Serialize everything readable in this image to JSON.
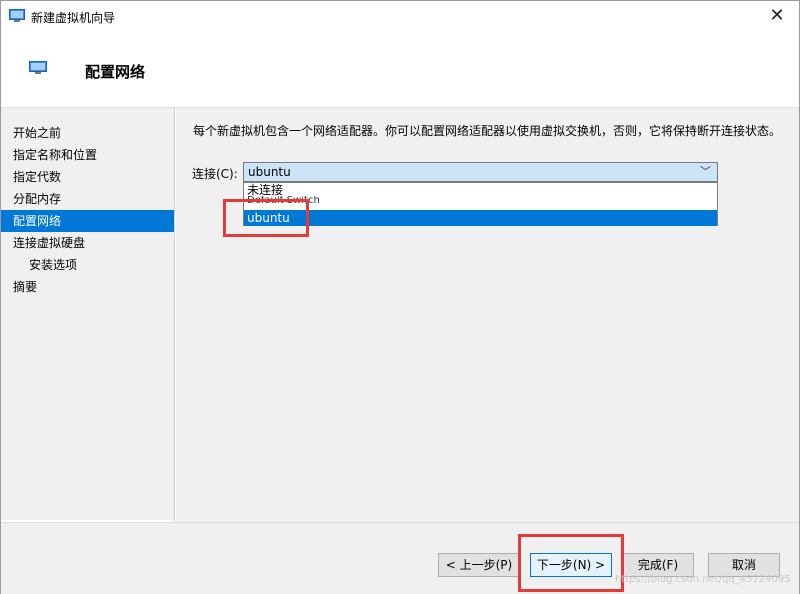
{
  "window": {
    "title": "新建虚拟机向导",
    "close_glyph": "✕"
  },
  "header": {
    "title": "配置网络"
  },
  "sidebar": {
    "items": [
      {
        "label": "开始之前"
      },
      {
        "label": "指定名称和位置"
      },
      {
        "label": "指定代数"
      },
      {
        "label": "分配内存"
      },
      {
        "label": "配置网络",
        "active": true
      },
      {
        "label": "连接虚拟硬盘"
      },
      {
        "label": "安装选项"
      },
      {
        "label": "摘要"
      }
    ]
  },
  "content": {
    "description": "每个新虚拟机包含一个网络适配器。你可以配置网络适配器以使用虚拟交换机，否则，它将保持断开连接状态。",
    "connection_label": "连接(C):",
    "connection_value": "ubuntu",
    "dropdown_options": [
      "未连接",
      "Default Switch",
      "ubuntu"
    ],
    "selected_option": "ubuntu"
  },
  "footer": {
    "back": "< 上一步(P)",
    "next": "下一步(N) >",
    "finish": "完成(F)",
    "cancel": "取消"
  },
  "watermark": "https://blog.csdn.net/qq_45724095",
  "colors": {
    "accent": "#0078d7",
    "highlight": "#e53a3a",
    "panel": "#f0f0f0"
  },
  "icons": [
    "vm-monitor-icon",
    "close-icon",
    "chevron-down-icon"
  ]
}
